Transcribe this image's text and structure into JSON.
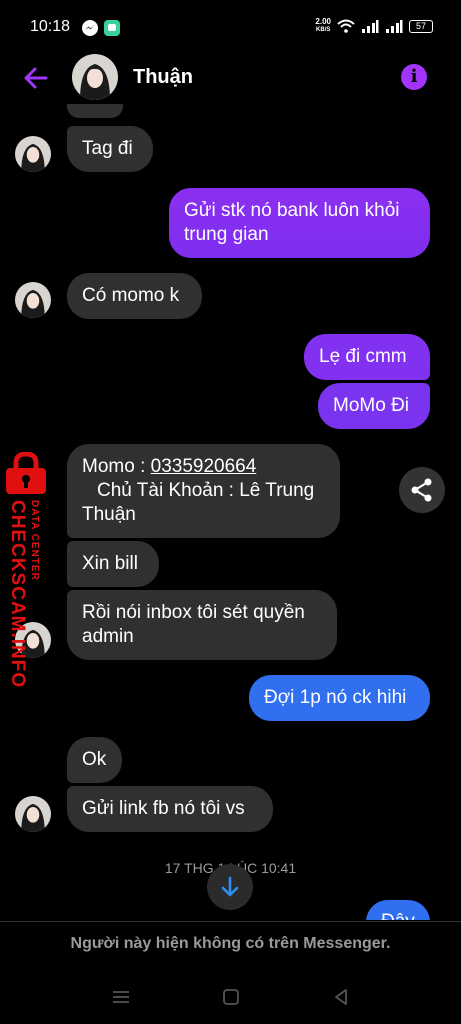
{
  "status_bar": {
    "time": "10:18",
    "net_speed_value": "2.00",
    "net_speed_unit": "KB/S",
    "battery": "57",
    "icons": [
      "messenger-icon",
      "chat-app-icon",
      "wifi-icon",
      "signal-icon",
      "battery-icon"
    ]
  },
  "header": {
    "contact_name": "Thuận",
    "back_icon": "back-arrow-icon",
    "info_icon": "info-icon",
    "info_glyph": "i"
  },
  "messages": [
    {
      "side": "in",
      "text": "Tag đi"
    },
    {
      "side": "out",
      "lines": [
        "Gửi stk nó bank luôn khỏi",
        "trung gian"
      ]
    },
    {
      "side": "in",
      "text": "Có momo k"
    },
    {
      "side": "out",
      "text": "Lẹ đi cmm"
    },
    {
      "side": "out",
      "text": "MoMo Đi"
    },
    {
      "side": "in",
      "label": "Momo : ",
      "phone": "0335920664",
      "owner_line": "Chủ Tài Khoản : Lê Trung",
      "name_line": "Thuận"
    },
    {
      "side": "in",
      "text": "Xin bill"
    },
    {
      "side": "in",
      "lines": [
        "Rồi nói inbox tôi sét quyền",
        "admin"
      ]
    },
    {
      "side": "out",
      "text": "Đợi 1p nó ck hihi"
    },
    {
      "side": "in",
      "text": "Ok"
    },
    {
      "side": "in",
      "text": "Gửi link fb nó tôi vs"
    },
    {
      "side": "out",
      "text": "Đây"
    }
  ],
  "timestamp": "17 THG 1 LÚC 10:41",
  "footer_notice": "Người này hiện không có trên Messenger.",
  "watermark": {
    "brand": "CHECKSCAM.INFO",
    "subtitle": "DATA CENTER",
    "icon": "padlock-icon"
  },
  "colors": {
    "outgoing_purple": "#8b2ff0",
    "outgoing_blue": "#2f6ff0",
    "incoming": "#303030",
    "accent": "#a334fa",
    "watermark_red": "#e01010"
  },
  "navbar": [
    "menu-icon",
    "home-square-icon",
    "back-triangle-icon"
  ]
}
